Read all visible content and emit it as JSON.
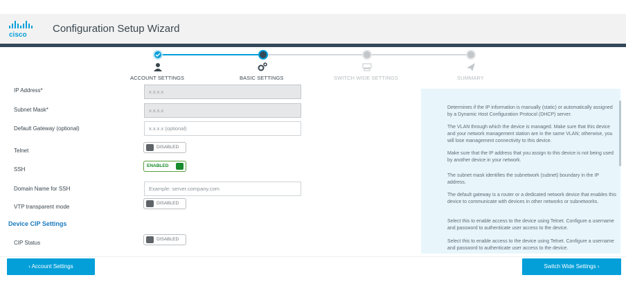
{
  "header": {
    "logo_text": "cisco",
    "title": "Configuration Setup Wizard"
  },
  "colors": {
    "accent": "#049fd9",
    "header_bar": "#34495a",
    "toggle_on": "#188b2b",
    "section_title": "#1a7bbf",
    "help_bg": "#e8f6fc"
  },
  "stepper": {
    "steps": [
      {
        "label": "ACCOUNT SETTINGS",
        "state": "completed",
        "icon": "user-icon"
      },
      {
        "label": "BASIC SETTINGS",
        "state": "current",
        "icon": "gears-icon"
      },
      {
        "label": "SWITCH WIDE SETTINGS",
        "state": "pending",
        "icon": "switch-icon"
      },
      {
        "label": "SUMMARY",
        "state": "pending",
        "icon": "send-icon"
      }
    ]
  },
  "form": {
    "ip_address": {
      "label": "IP Address*",
      "placeholder": "x.x.x.x"
    },
    "subnet_mask": {
      "label": "Subnet Mask*",
      "placeholder": "x.x.x.x"
    },
    "default_gateway": {
      "label": "Default Gateway (optional)",
      "placeholder": "x.x.x.x (optional)"
    },
    "telnet": {
      "label": "Telnet",
      "state": "DISABLED"
    },
    "ssh": {
      "label": "SSH",
      "state": "ENABLED"
    },
    "domain_name": {
      "label": "Domain Name for SSH",
      "placeholder": "Example: server.company.com"
    },
    "vtp_mode": {
      "label": "VTP transparent mode",
      "state": "DISABLED"
    },
    "cip_section_title": "Device CIP Settings",
    "cip_status": {
      "label": "CIP Status",
      "state": "DISABLED"
    }
  },
  "help": {
    "paragraphs": [
      "Determines if the IP information is manually (static) or automatically assigned by a Dynamic Host Configuration Protocol (DHCP) server.",
      "The VLAN through which the device is managed. Make sure that this device and your network management station are in the same VLAN; otherwise, you will lose management connectivity to this device.",
      "Make sure that the IP address that you assign to this device is not being used by another device in your network.",
      "The subnet mask identifies the subnetwork (subnet) boundary in the IP address.",
      "The default gateway is a router or a dedicated network device that enables this device to communicate with devices in other networks or subnetworks.",
      "Select this to enable access to the device using Telnet. Configure a username and password to authenticate user access to the device.",
      "Select this to enable access to the device using Telnet. Configure a username and password to authenticate user access to the device."
    ]
  },
  "footer": {
    "back_label": "‹ Account Settings",
    "next_label": "Switch Wide Settings ›"
  }
}
